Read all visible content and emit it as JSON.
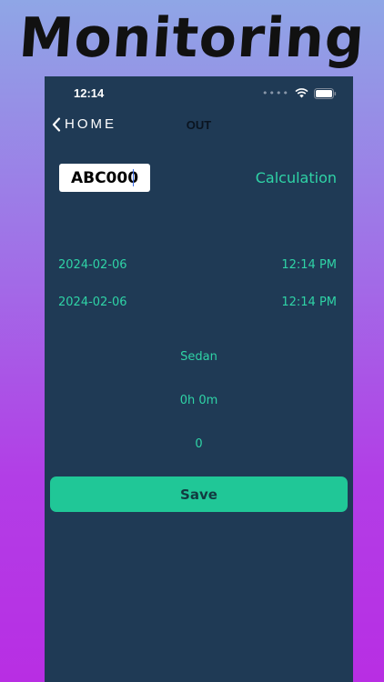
{
  "promo": {
    "title": "Monitoring"
  },
  "status_bar": {
    "time": "12:14"
  },
  "nav": {
    "back_label": "HOME",
    "title": "OUT"
  },
  "form": {
    "plate_value": "ABC000",
    "calculation_label": "Calculation",
    "entry_date": "2024-02-06",
    "entry_time": "12:14 PM",
    "exit_date": "2024-02-06",
    "exit_time": "12:14 PM",
    "vehicle_type": "Sedan",
    "duration": "0h 0m",
    "amount": "0",
    "save_label": "Save"
  },
  "colors": {
    "background_top": "#8fa6e6",
    "background_bottom": "#b82ee3",
    "screen": "#1f3a55",
    "accent": "#2fd3a6",
    "save_button": "#20c797"
  },
  "icons": [
    "wifi-icon",
    "battery-icon",
    "chevron-left-icon"
  ]
}
